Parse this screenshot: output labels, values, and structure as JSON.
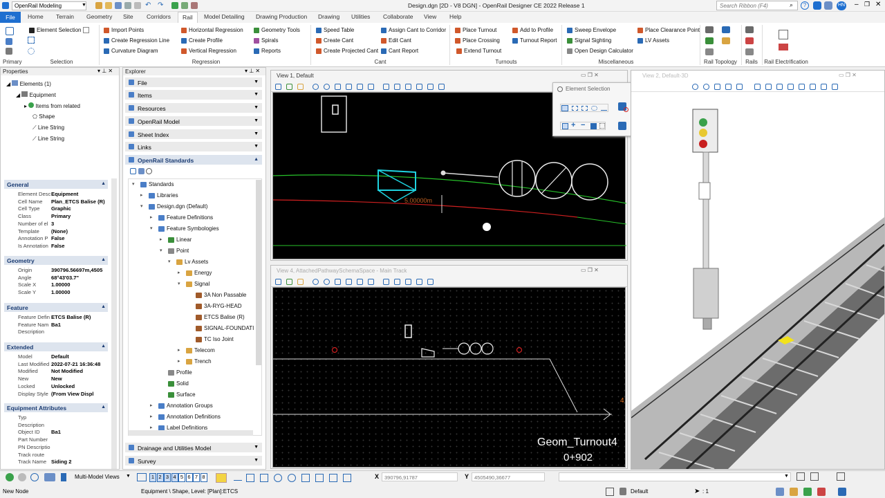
{
  "workflow": "OpenRail Modeling",
  "title": "Design.dgn [2D - V8 DGN] - OpenRail Designer CE 2022 Release 1",
  "search_placeholder": "Search Ribbon (F4)",
  "user_initials": "HN",
  "tabs": [
    "File",
    "Home",
    "Terrain",
    "Geometry",
    "Site",
    "Corridors",
    "Rail",
    "Model Detailing",
    "Drawing Production",
    "Drawing",
    "Utilities",
    "Collaborate",
    "View",
    "Help"
  ],
  "active_tab": "Rail",
  "ribbon": {
    "selection": {
      "element_selection": "Element Selection",
      "group": "Selection",
      "primary": "Primary"
    },
    "regression": {
      "import_points": "Import Points",
      "create_regression_line": "Create Regression Line",
      "curvature_diagram": "Curvature Diagram",
      "horizontal_regression": "Horizontal Regression",
      "create_profile": "Create Profile",
      "vertical_regression": "Vertical Regression",
      "geometry_tools": "Geometry Tools",
      "spirals": "Spirals",
      "reports": "Reports",
      "group": "Regression"
    },
    "cant": {
      "speed_table": "Speed Table",
      "create_cant": "Create Cant",
      "create_projected_cant": "Create Projected Cant",
      "assign_cant": "Assign Cant to Corridor",
      "edit_cant": "Edit Cant",
      "cant_report": "Cant Report",
      "group": "Cant"
    },
    "turnouts": {
      "place_turnout": "Place Turnout",
      "place_crossing": "Place Crossing",
      "extend_turnout": "Extend Turnout",
      "add_to_profile": "Add to Profile",
      "turnout_report": "Turnout Report",
      "group": "Turnouts"
    },
    "misc": {
      "sweep_envelope": "Sweep Envelope",
      "signal_sighting": "Signal Sighting",
      "open_design_calculator": "Open Design Calculator",
      "place_clearance_point": "Place Clearance Point",
      "lv_assets": "LV Assets",
      "group": "Miscellaneous"
    },
    "rail_topology": "Rail Topology",
    "rails": "Rails",
    "rail_electrification": "Rail Electrification"
  },
  "properties": {
    "title": "Properties",
    "tree": {
      "root": "Elements (1)",
      "equipment": "Equipment",
      "items_from_related": "Items from related",
      "shape": "Shape",
      "line1": "Line String",
      "line2": "Line String"
    },
    "general": {
      "header": "General",
      "rows": [
        [
          "Element Desc",
          "Equipment"
        ],
        [
          "Cell Name",
          "Plan_ETCS Balise (R)"
        ],
        [
          "Cell Type",
          "Graphic"
        ],
        [
          "Class",
          "Primary"
        ],
        [
          "Number of el",
          "3"
        ],
        [
          "Template",
          "(None)"
        ],
        [
          "Annotation P",
          "False"
        ],
        [
          "Is Annotation",
          "False"
        ]
      ]
    },
    "geometry": {
      "header": "Geometry",
      "rows": [
        [
          "Origin",
          "390796.56697m,4505"
        ],
        [
          "Angle",
          "68°43'03.7\""
        ],
        [
          "Scale X",
          "1.00000"
        ],
        [
          "Scale Y",
          "1.00000"
        ]
      ]
    },
    "feature": {
      "header": "Feature",
      "rows": [
        [
          "Feature Defin",
          "ETCS Balise (R)"
        ],
        [
          "Feature Nam",
          "Ba1"
        ],
        [
          "Description",
          ""
        ]
      ]
    },
    "extended": {
      "header": "Extended",
      "rows": [
        [
          "Model",
          "Default"
        ],
        [
          "Last Modified",
          "2022-07-21 16:36:48"
        ],
        [
          "Modified",
          "Not Modified"
        ],
        [
          "New",
          "New"
        ],
        [
          "Locked",
          "Unlocked"
        ],
        [
          "Display Style",
          "(From View Displ"
        ]
      ]
    },
    "equipment_attributes": {
      "header": "Equipment Attributes",
      "rows": [
        [
          "Typ",
          ""
        ],
        [
          "Description",
          ""
        ],
        [
          "Object ID",
          "Ba1"
        ],
        [
          "Part Number",
          ""
        ],
        [
          "PN Descriptio",
          ""
        ],
        [
          "Track route",
          ""
        ],
        [
          "Track Name",
          "Siding 2"
        ]
      ]
    }
  },
  "explorer": {
    "title": "Explorer",
    "sections": [
      "File",
      "Items",
      "Resources",
      "OpenRail Model",
      "Sheet Index",
      "Links"
    ],
    "open_section": "OpenRail Standards",
    "tree": [
      "Standards",
      "Libraries",
      "Design.dgn (Default)",
      "Feature Definitions",
      "Feature Symbologies",
      "Linear",
      "Point",
      "Lv Assets",
      "Energy",
      "Signal",
      "3A Non Passable",
      "3A-RYG-HEAD",
      "ETCS Balise (R)",
      "SIGNAL-FOUNDATI",
      "TC Iso Joint",
      "Telecom",
      "Trench",
      "Profile",
      "Solid",
      "Surface",
      "Annotation Groups",
      "Annotation Definitions",
      "Label Definitions"
    ],
    "bottom_sections": [
      "Drainage and Utilities Model",
      "Survey"
    ]
  },
  "views": {
    "view1": "View 1, Default",
    "view2": "View 2, Default-3D",
    "view4": "View 4, AttachedPathwaySchemaSpace - Main Track",
    "dimension": "5.00000m",
    "turnout_label": "Geom_Turnout4",
    "station_label": "0+902"
  },
  "element_selection_dialog": {
    "title": "Element Selection"
  },
  "status": {
    "x_label": "X",
    "x_value": "390796,91787",
    "y_label": "Y",
    "y_value": "4505490,36677",
    "multi_model": "Multi-Model Views",
    "view_numbers": [
      "1",
      "2",
      "3",
      "4",
      "5",
      "6",
      "7",
      "8"
    ],
    "message": "New Node",
    "prompt": "Equipment \\ Shape, Level: [Plan]:ETCS",
    "level": "Default",
    "count": ": 1"
  }
}
